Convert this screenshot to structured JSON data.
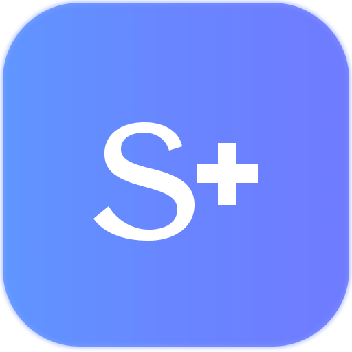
{
  "app_icon": {
    "name": "S+ app icon",
    "glyph_text": "S+",
    "colors": {
      "gradient_start": "#5f95ff",
      "gradient_mid": "#6a84ff",
      "gradient_end": "#6f7bff",
      "glyph": "#ffffff"
    },
    "glyph_parts": [
      "S",
      "+"
    ]
  }
}
